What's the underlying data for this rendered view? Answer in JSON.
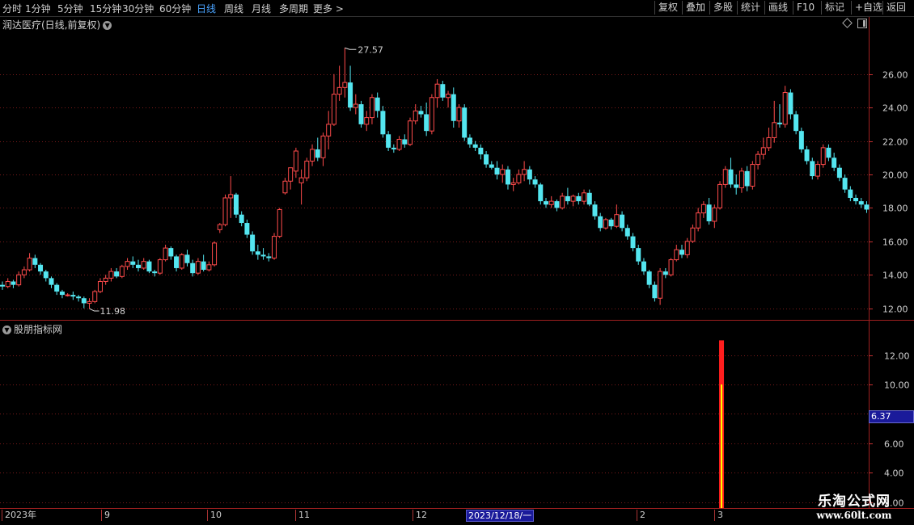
{
  "toolbar": {
    "periods": [
      {
        "label": "分时",
        "active": false
      },
      {
        "label": "1分钟",
        "active": false
      },
      {
        "label": "5分钟",
        "active": false
      },
      {
        "label": "15分钟",
        "active": false
      },
      {
        "label": "30分钟",
        "active": false
      },
      {
        "label": "60分钟",
        "active": false
      },
      {
        "label": "日线",
        "active": true
      },
      {
        "label": "周线",
        "active": false
      },
      {
        "label": "月线",
        "active": false
      },
      {
        "label": "多周期",
        "active": false
      },
      {
        "label": "更多 >",
        "active": false
      }
    ],
    "right_buttons": [
      "复权",
      "叠加",
      "多股",
      "统计",
      "画线",
      "F10",
      "标记",
      "+自选",
      "返回"
    ]
  },
  "stock": {
    "name_line": "润达医疗(日线,前复权)"
  },
  "indicator": {
    "name": "股朋指标网",
    "cursor_value": "6.37"
  },
  "date_cursor": "2023/12/18/一",
  "x_axis": [
    "2023年",
    "9",
    "10",
    "11",
    "12",
    "2",
    "3"
  ],
  "watermark": {
    "line1": "乐淘公式网",
    "line2": "www.60lt.com"
  },
  "colors": {
    "up": "#ff4b4b",
    "down": "#54e6f0",
    "bar_outer": "#ff1e1e",
    "bar_inner": "#ffff00",
    "grid": "#7a1a1a"
  },
  "chart_data": [
    {
      "type": "candlestick",
      "ylim": [
        11.5,
        28.5
      ],
      "yticks": [
        12,
        14,
        16,
        18,
        20,
        22,
        24,
        26
      ],
      "high_label": "27.57",
      "low_label": "11.98",
      "candles": [
        [
          13.4,
          13.6,
          13.1,
          13.3
        ],
        [
          13.3,
          13.8,
          13.2,
          13.6
        ],
        [
          13.6,
          13.7,
          13.2,
          13.4
        ],
        [
          13.4,
          14.2,
          13.3,
          14.0
        ],
        [
          14.0,
          14.5,
          13.8,
          14.3
        ],
        [
          14.3,
          15.3,
          14.2,
          15.0
        ],
        [
          15.0,
          15.2,
          14.4,
          14.6
        ],
        [
          14.6,
          14.7,
          14.0,
          14.2
        ],
        [
          14.2,
          14.3,
          13.6,
          13.8
        ],
        [
          13.8,
          13.9,
          13.2,
          13.4
        ],
        [
          13.4,
          13.5,
          12.8,
          13.0
        ],
        [
          13.0,
          13.1,
          12.6,
          12.8
        ],
        [
          12.8,
          12.9,
          12.7,
          12.8
        ],
        [
          12.8,
          13.0,
          12.5,
          12.7
        ],
        [
          12.7,
          12.8,
          12.4,
          12.6
        ],
        [
          12.6,
          12.7,
          12.0,
          12.3
        ],
        [
          12.3,
          12.6,
          11.98,
          12.4
        ],
        [
          12.4,
          13.1,
          12.3,
          13.0
        ],
        [
          13.0,
          13.8,
          12.9,
          13.6
        ],
        [
          13.6,
          14.0,
          13.4,
          13.8
        ],
        [
          13.8,
          14.4,
          13.6,
          14.2
        ],
        [
          14.2,
          14.4,
          13.8,
          13.9
        ],
        [
          13.9,
          14.6,
          13.8,
          14.5
        ],
        [
          14.5,
          15.0,
          14.3,
          14.8
        ],
        [
          14.8,
          15.1,
          14.4,
          14.6
        ],
        [
          14.6,
          14.9,
          14.2,
          14.4
        ],
        [
          14.4,
          15.0,
          14.3,
          14.8
        ],
        [
          14.8,
          14.9,
          14.1,
          14.2
        ],
        [
          14.2,
          14.3,
          13.9,
          14.1
        ],
        [
          14.1,
          15.0,
          14.0,
          14.9
        ],
        [
          14.9,
          15.8,
          14.8,
          15.6
        ],
        [
          15.6,
          15.7,
          14.9,
          15.1
        ],
        [
          15.1,
          15.2,
          14.2,
          14.4
        ],
        [
          14.4,
          15.3,
          14.3,
          15.2
        ],
        [
          15.2,
          15.5,
          14.5,
          14.7
        ],
        [
          14.7,
          14.9,
          13.9,
          14.1
        ],
        [
          14.1,
          15.0,
          14.0,
          14.8
        ],
        [
          14.8,
          15.2,
          14.2,
          14.3
        ],
        [
          14.3,
          14.8,
          14.2,
          14.6
        ],
        [
          14.6,
          16.0,
          14.5,
          15.9
        ],
        [
          16.7,
          17.1,
          16.5,
          17.0
        ],
        [
          17.0,
          18.8,
          16.9,
          18.6
        ],
        [
          18.6,
          19.9,
          17.4,
          18.8
        ],
        [
          18.8,
          18.9,
          17.4,
          17.6
        ],
        [
          17.6,
          17.8,
          16.9,
          17.1
        ],
        [
          17.1,
          17.3,
          16.2,
          16.4
        ],
        [
          16.4,
          16.6,
          15.2,
          15.4
        ],
        [
          15.4,
          15.8,
          14.9,
          15.2
        ],
        [
          15.2,
          15.6,
          14.9,
          15.1
        ],
        [
          15.1,
          15.3,
          14.8,
          15.0
        ],
        [
          15.0,
          16.5,
          14.9,
          16.3
        ],
        [
          16.3,
          18.0,
          16.2,
          17.9
        ],
        [
          18.9,
          19.8,
          18.8,
          19.6
        ],
        [
          19.6,
          20.1,
          19.1,
          20.4
        ],
        [
          20.2,
          21.6,
          19.8,
          21.4
        ],
        [
          19.5,
          20.3,
          18.2,
          19.8
        ],
        [
          19.8,
          21.0,
          19.6,
          20.8
        ],
        [
          20.8,
          21.8,
          20.5,
          21.5
        ],
        [
          21.5,
          22.2,
          20.8,
          21.0
        ],
        [
          21.0,
          22.5,
          20.5,
          22.3
        ],
        [
          22.3,
          23.8,
          21.5,
          23.0
        ],
        [
          23.0,
          26.0,
          22.9,
          24.8
        ],
        [
          24.8,
          26.5,
          24.4,
          25.2
        ],
        [
          25.2,
          27.57,
          24.6,
          25.5
        ],
        [
          25.5,
          26.5,
          23.8,
          24.0
        ],
        [
          24.0,
          24.8,
          23.6,
          24.2
        ],
        [
          24.2,
          24.4,
          22.8,
          23.0
        ],
        [
          23.0,
          23.8,
          22.6,
          23.4
        ],
        [
          23.4,
          24.8,
          23.0,
          24.6
        ],
        [
          24.6,
          24.9,
          23.4,
          23.8
        ],
        [
          23.8,
          24.1,
          22.2,
          22.4
        ],
        [
          22.4,
          22.6,
          21.4,
          21.6
        ],
        [
          21.6,
          21.8,
          21.3,
          21.5
        ],
        [
          21.5,
          22.3,
          21.4,
          22.1
        ],
        [
          22.1,
          22.4,
          21.6,
          21.8
        ],
        [
          21.8,
          23.4,
          21.7,
          23.2
        ],
        [
          23.2,
          24.2,
          23.0,
          23.8
        ],
        [
          23.8,
          24.1,
          23.4,
          23.6
        ],
        [
          23.6,
          24.3,
          22.3,
          22.6
        ],
        [
          22.6,
          24.8,
          22.4,
          24.6
        ],
        [
          24.6,
          25.7,
          24.0,
          25.4
        ],
        [
          25.4,
          25.6,
          24.4,
          24.6
        ],
        [
          24.6,
          25.0,
          24.0,
          24.8
        ],
        [
          24.8,
          25.2,
          22.8,
          23.2
        ],
        [
          23.2,
          24.2,
          22.8,
          24.0
        ],
        [
          24.0,
          24.2,
          22.0,
          22.2
        ],
        [
          22.2,
          22.4,
          21.6,
          21.8
        ],
        [
          21.8,
          22.0,
          21.4,
          21.6
        ],
        [
          21.6,
          21.8,
          20.9,
          21.2
        ],
        [
          21.2,
          21.4,
          20.4,
          20.6
        ],
        [
          20.6,
          20.8,
          20.3,
          20.4
        ],
        [
          20.4,
          20.8,
          19.7,
          20.0
        ],
        [
          20.0,
          20.6,
          19.5,
          20.3
        ],
        [
          20.3,
          20.5,
          19.1,
          19.4
        ],
        [
          19.4,
          19.8,
          19.0,
          19.5
        ],
        [
          19.5,
          20.3,
          19.4,
          20.0
        ],
        [
          20.0,
          20.8,
          19.6,
          20.3
        ],
        [
          20.3,
          20.5,
          19.4,
          19.7
        ],
        [
          19.7,
          19.9,
          19.2,
          19.4
        ],
        [
          19.4,
          19.5,
          18.2,
          18.4
        ],
        [
          18.4,
          18.6,
          18.0,
          18.2
        ],
        [
          18.2,
          18.7,
          18.0,
          18.4
        ],
        [
          18.4,
          18.5,
          17.8,
          18.0
        ],
        [
          18.0,
          18.9,
          17.9,
          18.7
        ],
        [
          18.7,
          19.2,
          18.2,
          18.4
        ],
        [
          18.4,
          18.8,
          18.1,
          18.7
        ],
        [
          18.7,
          18.9,
          18.2,
          18.4
        ],
        [
          18.4,
          19.1,
          18.2,
          18.9
        ],
        [
          18.9,
          19.1,
          18.1,
          18.2
        ],
        [
          18.2,
          18.4,
          17.3,
          17.5
        ],
        [
          17.5,
          17.7,
          16.6,
          16.8
        ],
        [
          16.8,
          17.4,
          16.7,
          17.3
        ],
        [
          17.3,
          17.4,
          16.7,
          16.9
        ],
        [
          16.9,
          18.2,
          16.8,
          17.6
        ],
        [
          17.6,
          17.8,
          16.6,
          16.8
        ],
        [
          16.8,
          17.0,
          16.1,
          16.3
        ],
        [
          16.3,
          16.5,
          15.4,
          15.6
        ],
        [
          15.6,
          15.8,
          14.6,
          14.8
        ],
        [
          14.8,
          15.0,
          14.0,
          14.2
        ],
        [
          14.2,
          14.3,
          13.2,
          13.4
        ],
        [
          13.4,
          13.6,
          12.4,
          12.6
        ],
        [
          12.6,
          14.4,
          12.2,
          14.2
        ],
        [
          14.2,
          14.4,
          13.8,
          14.0
        ],
        [
          14.0,
          15.0,
          13.9,
          14.9
        ],
        [
          14.9,
          15.8,
          14.8,
          15.5
        ],
        [
          15.5,
          15.8,
          15.0,
          15.2
        ],
        [
          15.2,
          16.2,
          15.0,
          16.0
        ],
        [
          16.0,
          17.0,
          15.9,
          16.8
        ],
        [
          16.8,
          18.0,
          16.6,
          17.7
        ],
        [
          17.7,
          18.4,
          17.4,
          18.2
        ],
        [
          18.2,
          18.6,
          17.0,
          17.2
        ],
        [
          17.2,
          18.2,
          16.8,
          18.0
        ],
        [
          18.0,
          19.6,
          17.9,
          19.4
        ],
        [
          19.4,
          20.5,
          19.2,
          20.3
        ],
        [
          20.3,
          21.0,
          19.2,
          19.4
        ],
        [
          19.4,
          20.0,
          18.8,
          19.2
        ],
        [
          19.2,
          20.4,
          18.9,
          20.2
        ],
        [
          20.2,
          20.5,
          19.0,
          19.3
        ],
        [
          19.3,
          20.8,
          19.1,
          20.6
        ],
        [
          20.6,
          21.4,
          20.3,
          21.2
        ],
        [
          21.2,
          22.2,
          20.9,
          21.6
        ],
        [
          21.6,
          22.8,
          21.4,
          22.2
        ],
        [
          22.2,
          24.4,
          21.9,
          23.1
        ],
        [
          23.1,
          24.2,
          22.8,
          23.0
        ],
        [
          23.0,
          25.3,
          22.8,
          24.9
        ],
        [
          24.9,
          25.1,
          23.3,
          23.6
        ],
        [
          23.6,
          23.8,
          22.4,
          22.6
        ],
        [
          22.6,
          22.8,
          21.3,
          21.5
        ],
        [
          21.5,
          21.7,
          20.6,
          20.8
        ],
        [
          20.8,
          21.0,
          19.7,
          19.9
        ],
        [
          19.9,
          20.8,
          19.7,
          20.6
        ],
        [
          20.6,
          21.8,
          20.4,
          21.6
        ],
        [
          21.6,
          21.8,
          20.8,
          21.0
        ],
        [
          21.0,
          21.3,
          20.2,
          20.4
        ],
        [
          20.4,
          20.6,
          19.6,
          19.8
        ],
        [
          19.8,
          20.0,
          18.9,
          19.1
        ],
        [
          19.1,
          19.3,
          18.4,
          18.6
        ],
        [
          18.6,
          18.8,
          18.2,
          18.4
        ],
        [
          18.4,
          18.6,
          18.0,
          18.2
        ],
        [
          18.2,
          18.4,
          17.7,
          17.9
        ]
      ]
    },
    {
      "type": "bar",
      "ylim": [
        1.6,
        13.9
      ],
      "yticks": [
        2.0,
        4.0,
        6.0,
        8.0,
        10.0,
        12.0
      ],
      "bars": [
        {
          "index": 132,
          "outer": 13.0,
          "inner": 10.0
        }
      ]
    }
  ]
}
